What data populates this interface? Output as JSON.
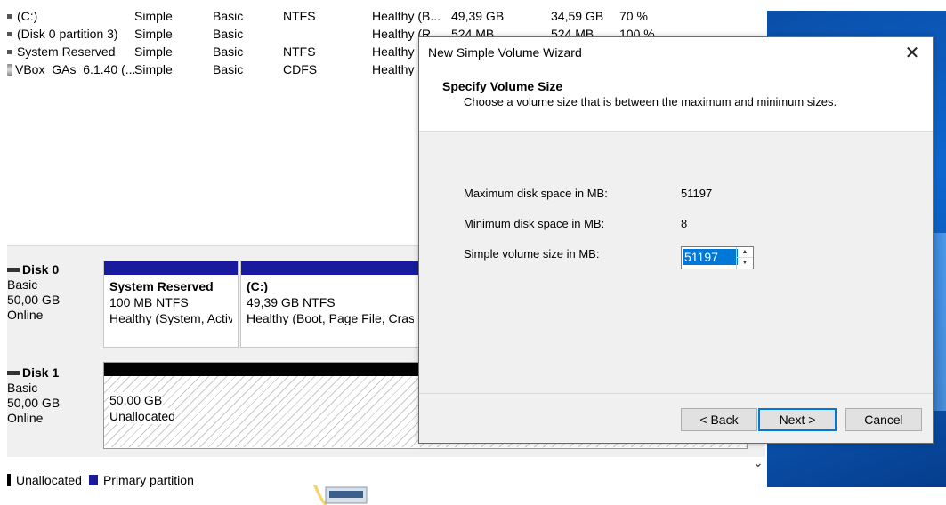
{
  "volumes": [
    {
      "name": "(C:)",
      "layout": "Simple",
      "type": "Basic",
      "fs": "NTFS",
      "status": "Healthy (B...",
      "capacity": "49,39 GB",
      "free": "34,59 GB",
      "pct": "70 %",
      "icon": "volume-icon"
    },
    {
      "name": "(Disk 0 partition 3)",
      "layout": "Simple",
      "type": "Basic",
      "fs": "",
      "status": "Healthy (R...",
      "capacity": "524 MB",
      "free": "524 MB",
      "pct": "100 %",
      "icon": "volume-icon"
    },
    {
      "name": "System Reserved",
      "layout": "Simple",
      "type": "Basic",
      "fs": "NTFS",
      "status": "Healthy",
      "capacity": "",
      "free": "",
      "pct": "",
      "icon": "volume-icon"
    },
    {
      "name": "VBox_GAs_6.1.40 (...",
      "layout": "Simple",
      "type": "Basic",
      "fs": "CDFS",
      "status": "Healthy",
      "capacity": "",
      "free": "",
      "pct": "",
      "icon": "cd-icon"
    }
  ],
  "disks": [
    {
      "name": "Disk 0",
      "type": "Basic",
      "size": "50,00 GB",
      "state": "Online"
    },
    {
      "name": "Disk 1",
      "type": "Basic",
      "size": "50,00 GB",
      "state": "Online"
    }
  ],
  "partitions": {
    "sysres": {
      "name": "System Reserved",
      "info": "100 MB NTFS",
      "status": "Healthy (System, Activ"
    },
    "c": {
      "name": "(C:)",
      "info": "49,39 GB NTFS",
      "status": "Healthy (Boot, Page File, Crash"
    },
    "unalloc": {
      "size": "50,00 GB",
      "status": "Unallocated"
    }
  },
  "legend": {
    "unallocated": "Unallocated",
    "primary": "Primary partition"
  },
  "wizard": {
    "title": "New Simple Volume Wizard",
    "heading": "Specify Volume Size",
    "subheading": "Choose a volume size that is between the maximum and minimum sizes.",
    "max_label": "Maximum disk space in MB:",
    "max_value": "51197",
    "min_label": "Minimum disk space in MB:",
    "min_value": "8",
    "size_label": "Simple volume size in MB:",
    "size_value": "51197",
    "back": "< Back",
    "next": "Next >",
    "cancel": "Cancel"
  },
  "colors": {
    "primary_partition": "#1a1a9e",
    "unallocated": "#000000",
    "accent": "#0078d7"
  }
}
